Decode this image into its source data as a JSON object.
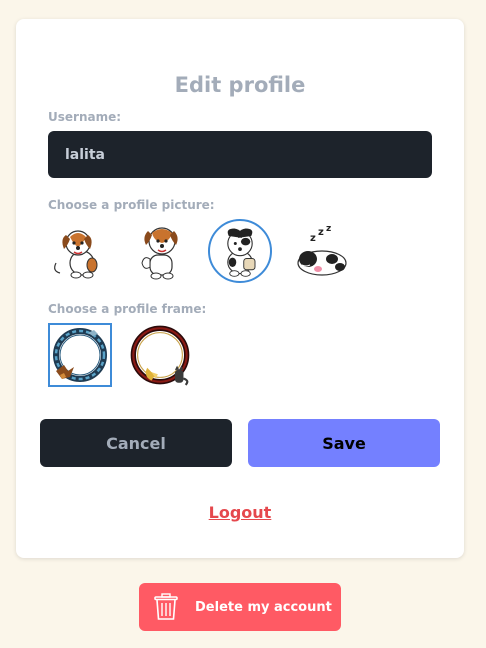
{
  "dialog": {
    "title": "Edit profile",
    "username_label": "Username:",
    "username_value": "lalita",
    "picture_label": "Choose a profile picture:",
    "frame_label": "Choose a profile frame:",
    "pictures": [
      {
        "icon": "dog-sitting-icon",
        "selected": false
      },
      {
        "icon": "dog-waving-icon",
        "selected": false
      },
      {
        "icon": "dog-eating-icon",
        "selected": true
      },
      {
        "icon": "dog-sleeping-icon",
        "selected": false
      }
    ],
    "frames": [
      {
        "icon": "blue-eagle-frame-icon",
        "selected": true
      },
      {
        "icon": "dark-red-cat-frame-icon",
        "selected": false
      }
    ],
    "cancel_label": "Cancel",
    "save_label": "Save",
    "logout_label": "Logout"
  },
  "delete_account": {
    "label": "Delete my account",
    "icon": "trash-icon"
  },
  "colors": {
    "background": "#fbf6ea",
    "accent": "#7480ff",
    "danger": "#ff5a64",
    "input_bg": "#1d232b",
    "selected_border": "#3e8bd8"
  }
}
